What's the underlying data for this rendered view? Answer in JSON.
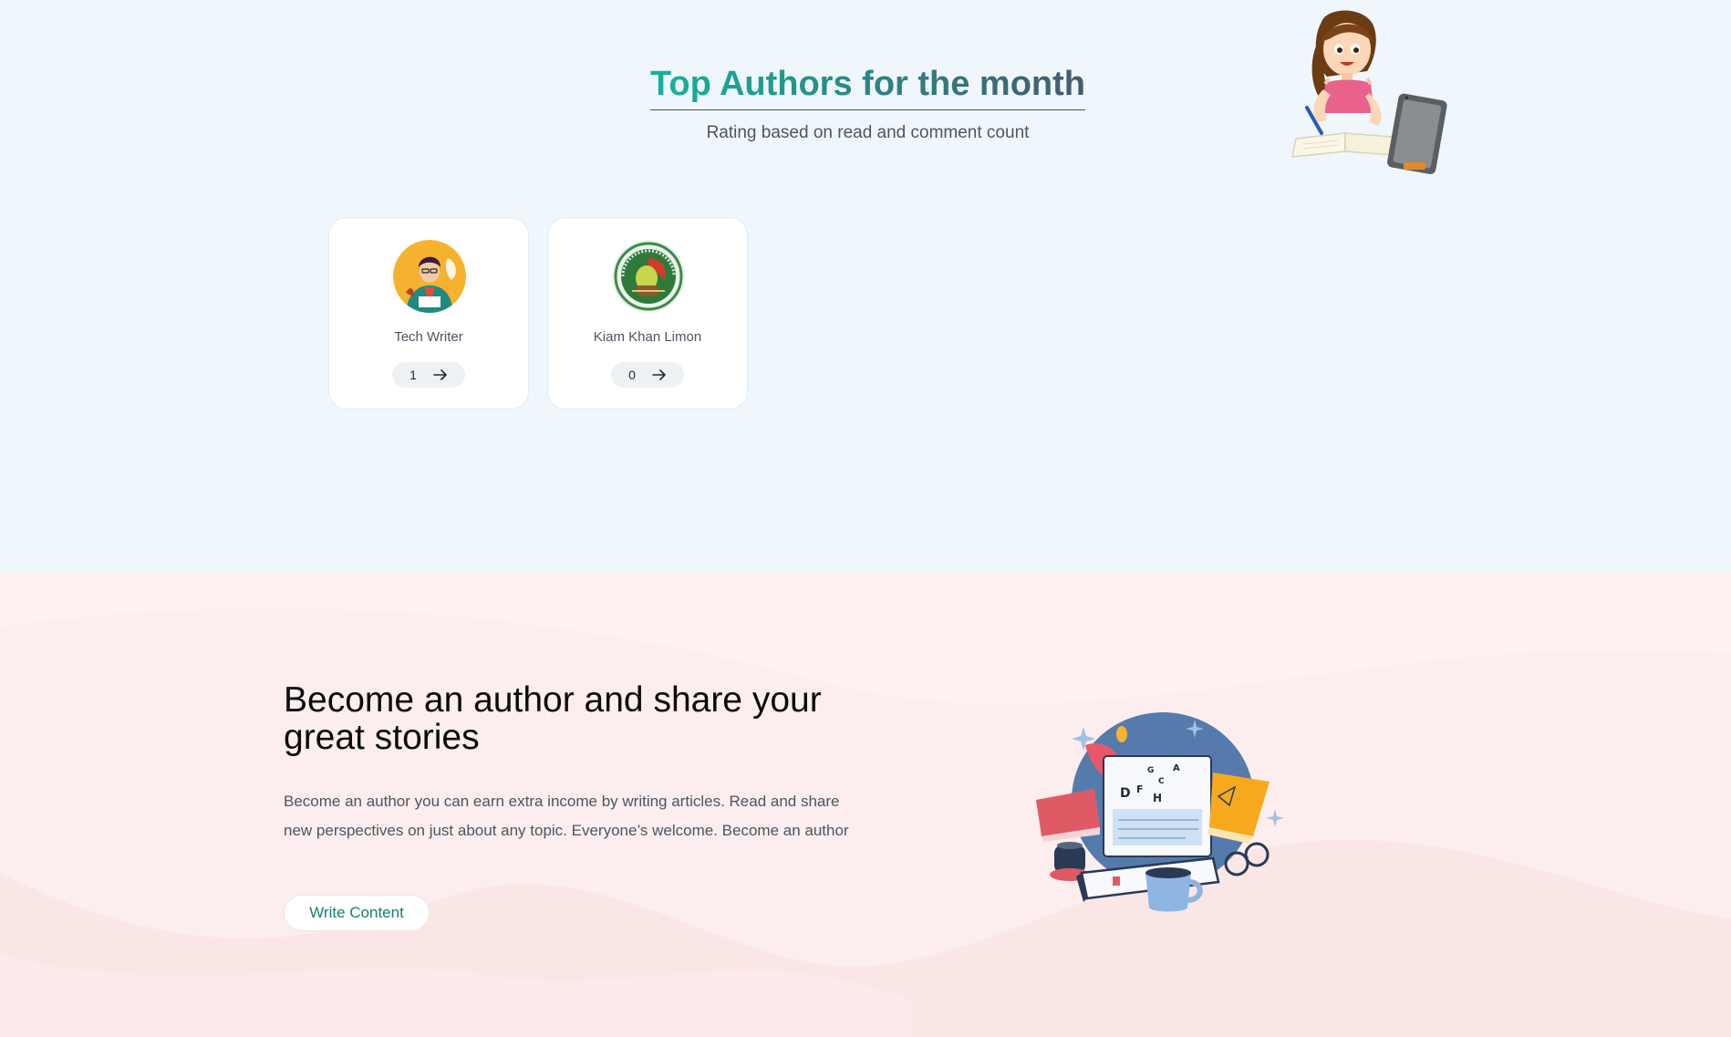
{
  "top_authors": {
    "title": "Top Authors for the month",
    "subtitle": "Rating based on read and comment count",
    "authors": [
      {
        "name": "Tech Writer",
        "count": "1"
      },
      {
        "name": "Kiam Khan Limon",
        "count": "0"
      }
    ]
  },
  "become_author": {
    "title": "Become an author and share your great stories",
    "description": "Become an author you can earn extra income by writing articles. Read and share new perspectives on just about any topic. Everyone’s welcome. Become an author",
    "button_label": "Write Content"
  },
  "illustration_letters": {
    "a": "D",
    "b": "F",
    "c": "H",
    "d": "A",
    "e": "G",
    "f": "C"
  },
  "colors": {
    "accent_teal": "#16b39b",
    "top_bg": "#eff7fd",
    "bottom_bg": "#fdf1f1"
  }
}
